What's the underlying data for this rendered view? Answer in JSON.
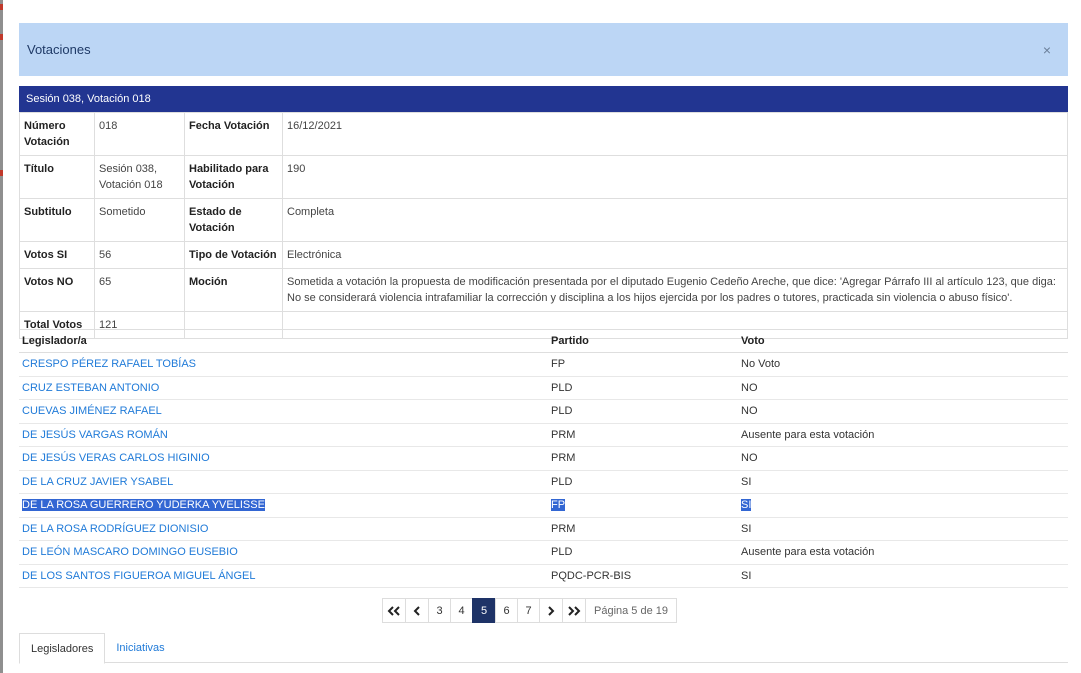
{
  "modal": {
    "title": "Votaciones",
    "close_label": "×"
  },
  "session": {
    "header": "Sesión 038, Votación 018"
  },
  "info": {
    "numero_label": "Número Votación",
    "numero_value": "018",
    "fecha_label": "Fecha Votación",
    "fecha_value": "16/12/2021",
    "titulo_label": "Título",
    "titulo_value": "Sesión 038, Votación 018",
    "habilitado_label": "Habilitado para Votación",
    "habilitado_value": "190",
    "subtitulo_label": "Subtitulo",
    "subtitulo_value": "Sometido",
    "estado_label": "Estado de Votación",
    "estado_value": "Completa",
    "votos_si_label": "Votos SI",
    "votos_si_value": "56",
    "tipo_label": "Tipo de Votación",
    "tipo_value": "Electrónica",
    "votos_no_label": "Votos NO",
    "votos_no_value": "65",
    "mocion_label": "Moción",
    "mocion_value": "Sometida a votación la propuesta de modificación presentada por el diputado Eugenio Cedeño Areche, que dice: 'Agregar Párrafo III al artículo 123, que diga: No se considerará violencia intrafamiliar la corrección y disciplina a los hijos ejercida por los padres o tutores, practicada sin violencia o abuso físico'.",
    "total_label": "Total Votos",
    "total_value": "121"
  },
  "legislators": {
    "headers": {
      "name": "Legislador/a",
      "party": "Partido",
      "vote": "Voto"
    },
    "rows": [
      {
        "name": "CRESPO PÉREZ RAFAEL TOBÍAS",
        "party": "FP",
        "vote": "No Voto"
      },
      {
        "name": "CRUZ ESTEBAN ANTONIO",
        "party": "PLD",
        "vote": "NO"
      },
      {
        "name": "CUEVAS JIMÉNEZ RAFAEL",
        "party": "PLD",
        "vote": "NO"
      },
      {
        "name": "DE JESÚS VARGAS ROMÁN",
        "party": "PRM",
        "vote": "Ausente para esta votación"
      },
      {
        "name": "DE JESÚS VERAS CARLOS HIGINIO",
        "party": "PRM",
        "vote": "NO"
      },
      {
        "name": "DE LA CRUZ JAVIER YSABEL",
        "party": "PLD",
        "vote": "SI"
      },
      {
        "name": "DE LA ROSA GUERRERO YUDERKA YVELISSE",
        "party": "FP",
        "vote": "SI"
      },
      {
        "name": "DE LA ROSA RODRÍGUEZ DIONISIO",
        "party": "PRM",
        "vote": "SI"
      },
      {
        "name": "DE LEÓN MASCARO DOMINGO EUSEBIO",
        "party": "PLD",
        "vote": "Ausente para esta votación"
      },
      {
        "name": "DE LOS SANTOS FIGUEROA MIGUEL ÁNGEL",
        "party": "PQDC-PCR-BIS",
        "vote": "SI"
      }
    ]
  },
  "pagination": {
    "first": "«",
    "prev": "‹",
    "next": "›",
    "last": "»",
    "pages": [
      "3",
      "4",
      "5",
      "6",
      "7"
    ],
    "current": "5",
    "label": "Página 5 de 19"
  },
  "tabs": [
    {
      "label": "Legisladores"
    },
    {
      "label": "Iniciativas"
    }
  ],
  "colors": {
    "header_bg": "#bcd6f5",
    "session_bar": "#223591",
    "link": "#1f7ad8",
    "active_page": "#1e3367",
    "selection": "#3266d3"
  }
}
